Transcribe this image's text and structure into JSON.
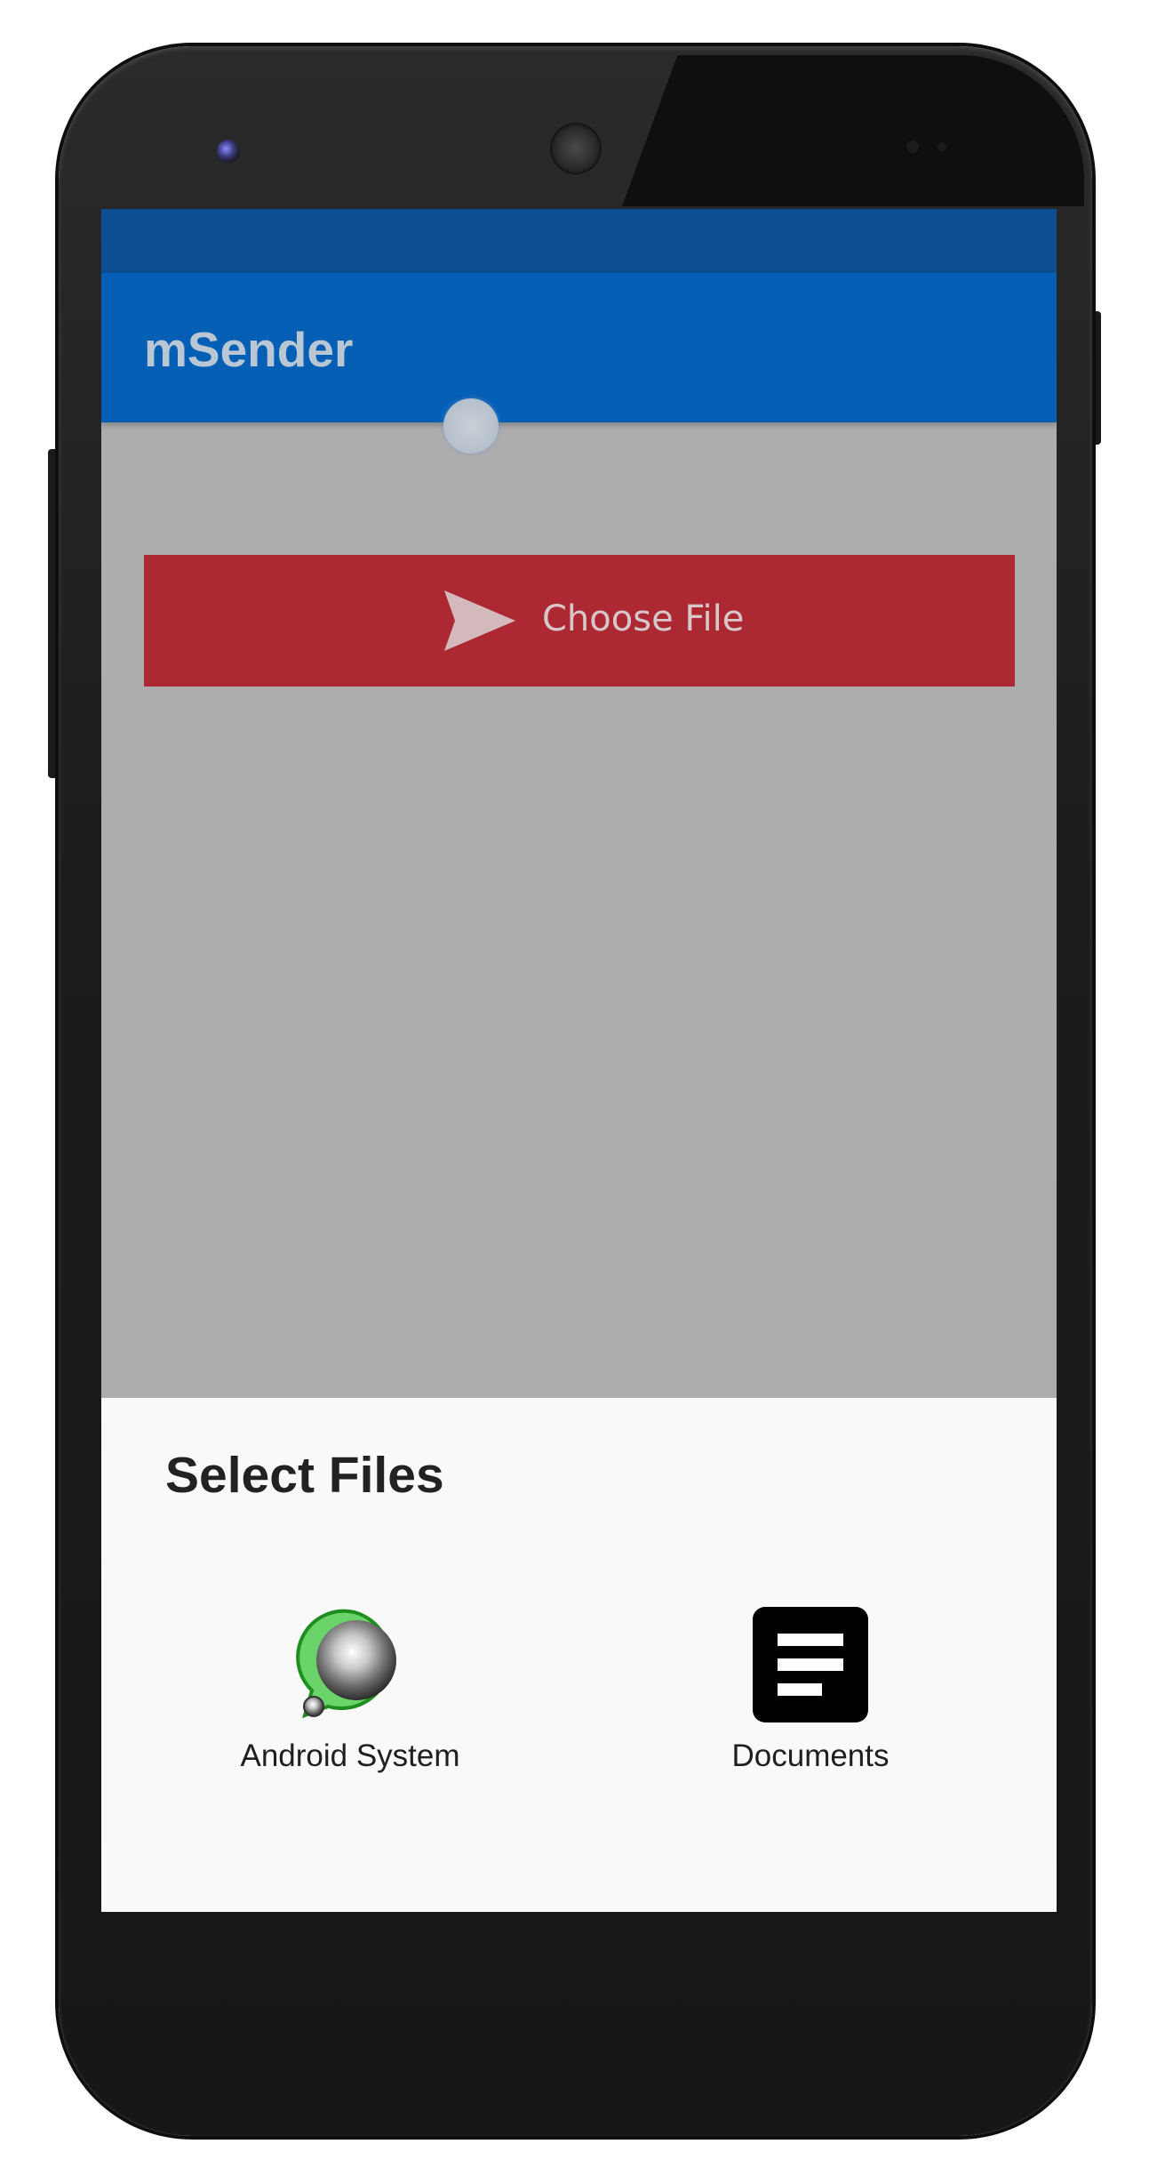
{
  "app": {
    "title": "mSender"
  },
  "main": {
    "choose_button": {
      "label": "Choose File",
      "icon": "send-icon",
      "color": "#ac2934"
    }
  },
  "bottom_sheet": {
    "title": "Select Files",
    "options": [
      {
        "label": "Android System",
        "icon": "android-system-icon"
      },
      {
        "label": "Documents",
        "icon": "documents-icon"
      }
    ]
  },
  "colors": {
    "status_bar": "#0c4f93",
    "app_bar": "#055fb5",
    "scrim": "#adadad",
    "sheet": "#f9f9f9"
  }
}
